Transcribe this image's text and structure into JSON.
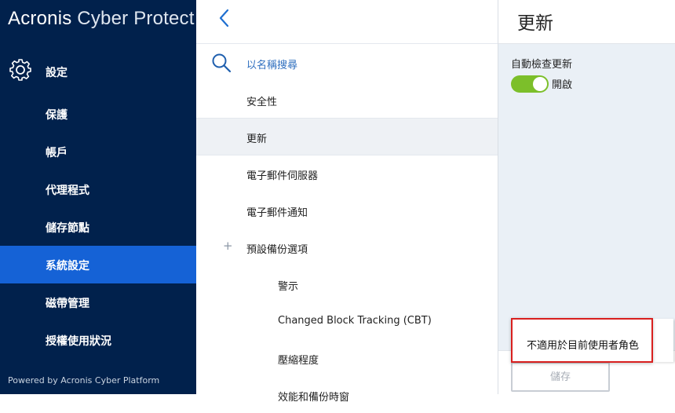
{
  "brand": {
    "name_bold": "Acronis",
    "name_light": " Cyber Protect"
  },
  "sidebar": {
    "header_label": "設定",
    "items": [
      {
        "label": "保護"
      },
      {
        "label": "帳戶"
      },
      {
        "label": "代理程式"
      },
      {
        "label": "儲存節點"
      },
      {
        "label": "系統設定",
        "active": true
      },
      {
        "label": "磁帶管理"
      },
      {
        "label": "授權使用狀況"
      }
    ],
    "powered_by": "Powered by Acronis Cyber Platform"
  },
  "middle": {
    "search_placeholder": "以名稱搜尋",
    "items": [
      {
        "label": "安全性"
      },
      {
        "label": "更新",
        "selected": true
      },
      {
        "label": "電子郵件伺服器"
      },
      {
        "label": "電子郵件通知"
      },
      {
        "label": "預設備份選項",
        "expand": "+"
      },
      {
        "label": "警示"
      },
      {
        "label": "Changed Block Tracking (CBT)"
      },
      {
        "label": "壓縮程度"
      },
      {
        "label": "效能和備份時窗"
      }
    ]
  },
  "right": {
    "title": "更新",
    "auto_check_label": "自動檢查更新",
    "toggle_state": "開啟",
    "toggle_on": true,
    "save_label": "儲存"
  },
  "tooltip": {
    "text": "不適用於目前使用者角色"
  },
  "colors": {
    "sidebar_bg": "#01214c",
    "active_item": "#1562d6",
    "toggle_on": "#7cbf2a",
    "tooltip_border": "#d9201f"
  }
}
